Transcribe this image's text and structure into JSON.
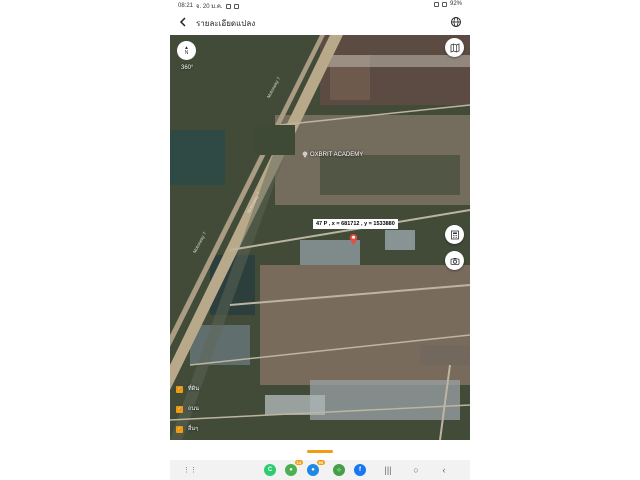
{
  "status": {
    "time": "08:21",
    "date": "จ. 20 ม.ค.",
    "battery": "92%"
  },
  "header": {
    "title": "รายละเอียดแปลง"
  },
  "map": {
    "compass_n": "N",
    "compass_label": "360°",
    "poi_label": "OXBRIT ACADEMY",
    "coordinate_popup": "47 P , x = 681712 , y = 1533880",
    "road_labels": [
      "Motorway 7",
      "Motorway 7",
      "Motorway 7"
    ],
    "legend": [
      "ที่ดิน",
      "ถนน",
      "อื่นๆ"
    ]
  },
  "apps": {
    "badge_1": "13",
    "badge_2": "99"
  },
  "colors": {
    "accent": "#f39c12",
    "pin": "#e74c3c"
  }
}
